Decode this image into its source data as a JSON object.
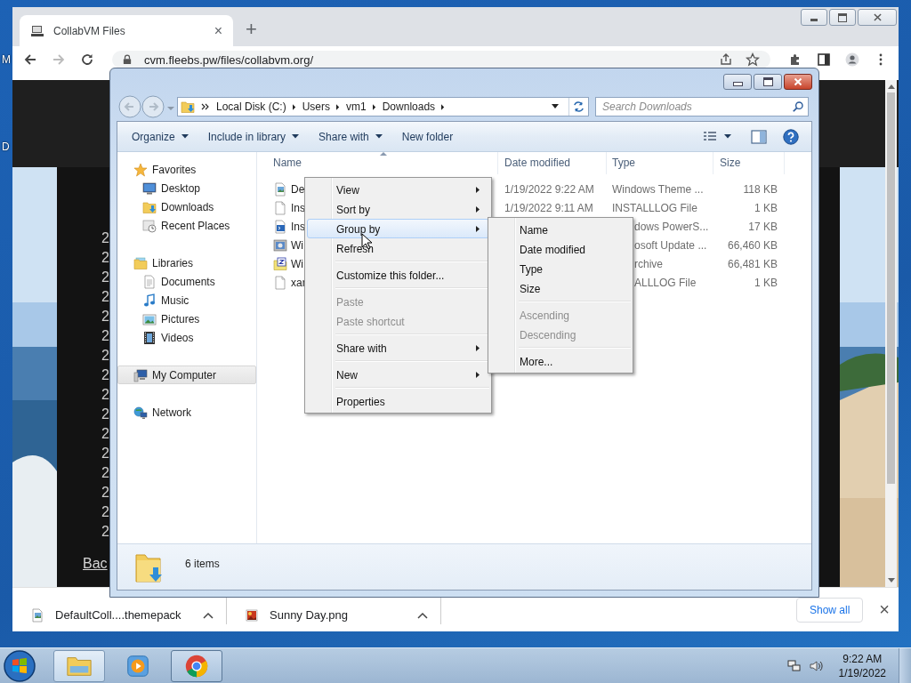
{
  "desktop": {
    "labels": [
      "M",
      "D"
    ]
  },
  "browser": {
    "tab": {
      "title": "CollabVM Files",
      "close": "×"
    },
    "new_tab": "+",
    "url": "cvm.fleebs.pw/files/collabvm.org/",
    "page": {
      "line_numbers": [
        "2",
        "2",
        "2",
        "2",
        "2",
        "2",
        "2",
        "2",
        "2",
        "2",
        "2",
        "2",
        "2",
        "2",
        "2",
        "2"
      ],
      "link": "Bac"
    },
    "downloads": [
      {
        "name": "DefaultColl....themepack",
        "kind": "theme"
      },
      {
        "name": "Sunny Day.png",
        "kind": "png"
      }
    ],
    "show_all": "Show all",
    "close": "×"
  },
  "explorer": {
    "breadcrumb": [
      "Local Disk (C:)",
      "Users",
      "vm1",
      "Downloads"
    ],
    "search": {
      "placeholder": "Search Downloads"
    },
    "toolbar": [
      {
        "label": "Organize",
        "dropdown": true
      },
      {
        "label": "Include in library",
        "dropdown": true
      },
      {
        "label": "Share with",
        "dropdown": true
      },
      {
        "label": "New folder",
        "dropdown": false
      }
    ],
    "sidebar": [
      {
        "label": "Favorites",
        "kind": "star",
        "selected": false,
        "children": [
          {
            "label": "Desktop",
            "kind": "desktop",
            "selected": false
          },
          {
            "label": "Downloads",
            "kind": "downloads",
            "selected": false
          },
          {
            "label": "Recent Places",
            "kind": "recent",
            "selected": false
          }
        ]
      },
      {
        "label": "Libraries",
        "kind": "libraries",
        "selected": false,
        "children": [
          {
            "label": "Documents",
            "kind": "document",
            "selected": false
          },
          {
            "label": "Music",
            "kind": "music",
            "selected": false
          },
          {
            "label": "Pictures",
            "kind": "pictures",
            "selected": false
          },
          {
            "label": "Videos",
            "kind": "videos",
            "selected": false
          }
        ]
      },
      {
        "label": "My Computer",
        "kind": "computer",
        "selected": true
      },
      {
        "label": "Network",
        "kind": "network",
        "selected": false
      }
    ],
    "columns": [
      "Name",
      "Date modified",
      "Type",
      "Size"
    ],
    "files": [
      {
        "name": "De",
        "kind": "theme",
        "date": "1/19/2022 9:22 AM",
        "type": "Windows Theme ...",
        "size": "118 KB"
      },
      {
        "name": "Ins",
        "kind": "log",
        "date": "1/19/2022 9:11 AM",
        "type": "INSTALLLOG File",
        "size": "1 KB"
      },
      {
        "name": "Ins",
        "kind": "script",
        "type": "dows PowerS...",
        "size": "17 KB"
      },
      {
        "name": "Wi",
        "kind": "package",
        "type": "osoft Update ...",
        "size": "66,460 KB"
      },
      {
        "name": "Wi",
        "kind": "archive",
        "type": "rchive",
        "size": "66,481 KB"
      },
      {
        "name": "xar",
        "kind": "log",
        "type": "ALLLOG File",
        "size": "1 KB"
      }
    ],
    "status": "6 items"
  },
  "context_menu": [
    {
      "kind": "item",
      "label": "View",
      "submenu": true,
      "disabled": false,
      "selected": false
    },
    {
      "kind": "item",
      "label": "Sort by",
      "submenu": true,
      "disabled": false,
      "selected": false
    },
    {
      "kind": "item",
      "label": "Group by",
      "submenu": true,
      "disabled": false,
      "selected": true
    },
    {
      "kind": "item",
      "label": "Refresh",
      "submenu": false,
      "disabled": false,
      "selected": false
    },
    {
      "kind": "separator"
    },
    {
      "kind": "item",
      "label": "Customize this folder...",
      "submenu": false,
      "disabled": false,
      "selected": false
    },
    {
      "kind": "separator"
    },
    {
      "kind": "item",
      "label": "Paste",
      "submenu": false,
      "disabled": true,
      "selected": false
    },
    {
      "kind": "item",
      "label": "Paste shortcut",
      "submenu": false,
      "disabled": true,
      "selected": false
    },
    {
      "kind": "separator"
    },
    {
      "kind": "item",
      "label": "Share with",
      "submenu": true,
      "disabled": false,
      "selected": false
    },
    {
      "kind": "separator"
    },
    {
      "kind": "item",
      "label": "New",
      "submenu": true,
      "disabled": false,
      "selected": false
    },
    {
      "kind": "separator"
    },
    {
      "kind": "item",
      "label": "Properties",
      "submenu": false,
      "disabled": false,
      "selected": false
    }
  ],
  "submenu": [
    {
      "kind": "item",
      "label": "Name",
      "disabled": false
    },
    {
      "kind": "item",
      "label": "Date modified",
      "disabled": false
    },
    {
      "kind": "item",
      "label": "Type",
      "disabled": false
    },
    {
      "kind": "item",
      "label": "Size",
      "disabled": false
    },
    {
      "kind": "separator"
    },
    {
      "kind": "item",
      "label": "Ascending",
      "disabled": true
    },
    {
      "kind": "item",
      "label": "Descending",
      "disabled": true
    },
    {
      "kind": "separator"
    },
    {
      "kind": "item",
      "label": "More...",
      "disabled": false
    }
  ],
  "taskbar": {
    "apps": [
      {
        "kind": "explorer",
        "selected": true
      },
      {
        "kind": "media",
        "selected": false
      },
      {
        "kind": "chrome",
        "selected": false,
        "open": true
      }
    ],
    "time": "9:22 AM",
    "date": "1/19/2022"
  }
}
